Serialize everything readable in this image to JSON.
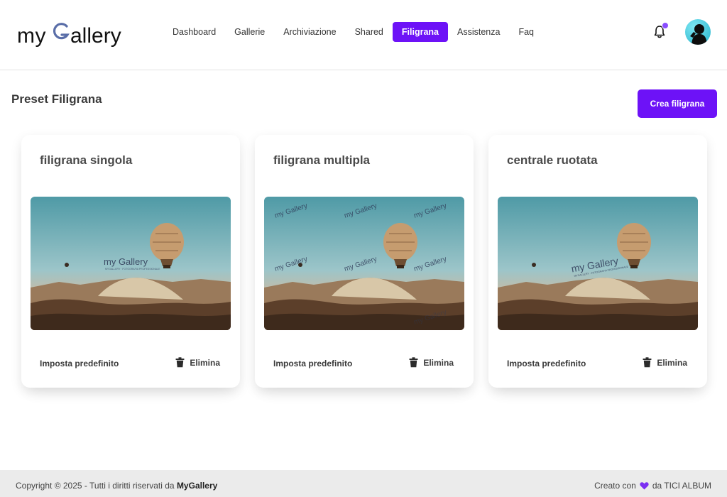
{
  "header": {
    "logo": {
      "part1": "my",
      "part2": "allery"
    },
    "nav": [
      {
        "label": "Dashboard",
        "active": false
      },
      {
        "label": "Gallerie",
        "active": false
      },
      {
        "label": "Archiviazione",
        "active": false
      },
      {
        "label": "Shared",
        "active": false
      },
      {
        "label": "Filigrana",
        "active": true
      },
      {
        "label": "Assistenza",
        "active": false
      },
      {
        "label": "Faq",
        "active": false
      }
    ],
    "notification_icon": "bell-icon",
    "avatar_icon": "user-avatar"
  },
  "main": {
    "title": "Preset Filigrana",
    "create_button": "Crea filigrana",
    "cards": [
      {
        "title": "filigrana singola",
        "watermark_mode": "single",
        "set_default": "Imposta predefinito",
        "delete": "Elimina"
      },
      {
        "title": "filigrana multipla",
        "watermark_mode": "multiple",
        "set_default": "Imposta predefinito",
        "delete": "Elimina"
      },
      {
        "title": "centrale ruotata",
        "watermark_mode": "rotated",
        "set_default": "Imposta predefinito",
        "delete": "Elimina"
      }
    ]
  },
  "footer": {
    "copyright_prefix": "Copyright © 2025 - Tutti i diritti riservati da",
    "brand": "MyGallery",
    "made_with": "Creato con",
    "made_by": "da TICI ALBUM"
  },
  "colors": {
    "accent": "#6d12f7",
    "notification_dot": "#8a4dff",
    "footer_bg": "#ebebeb"
  }
}
